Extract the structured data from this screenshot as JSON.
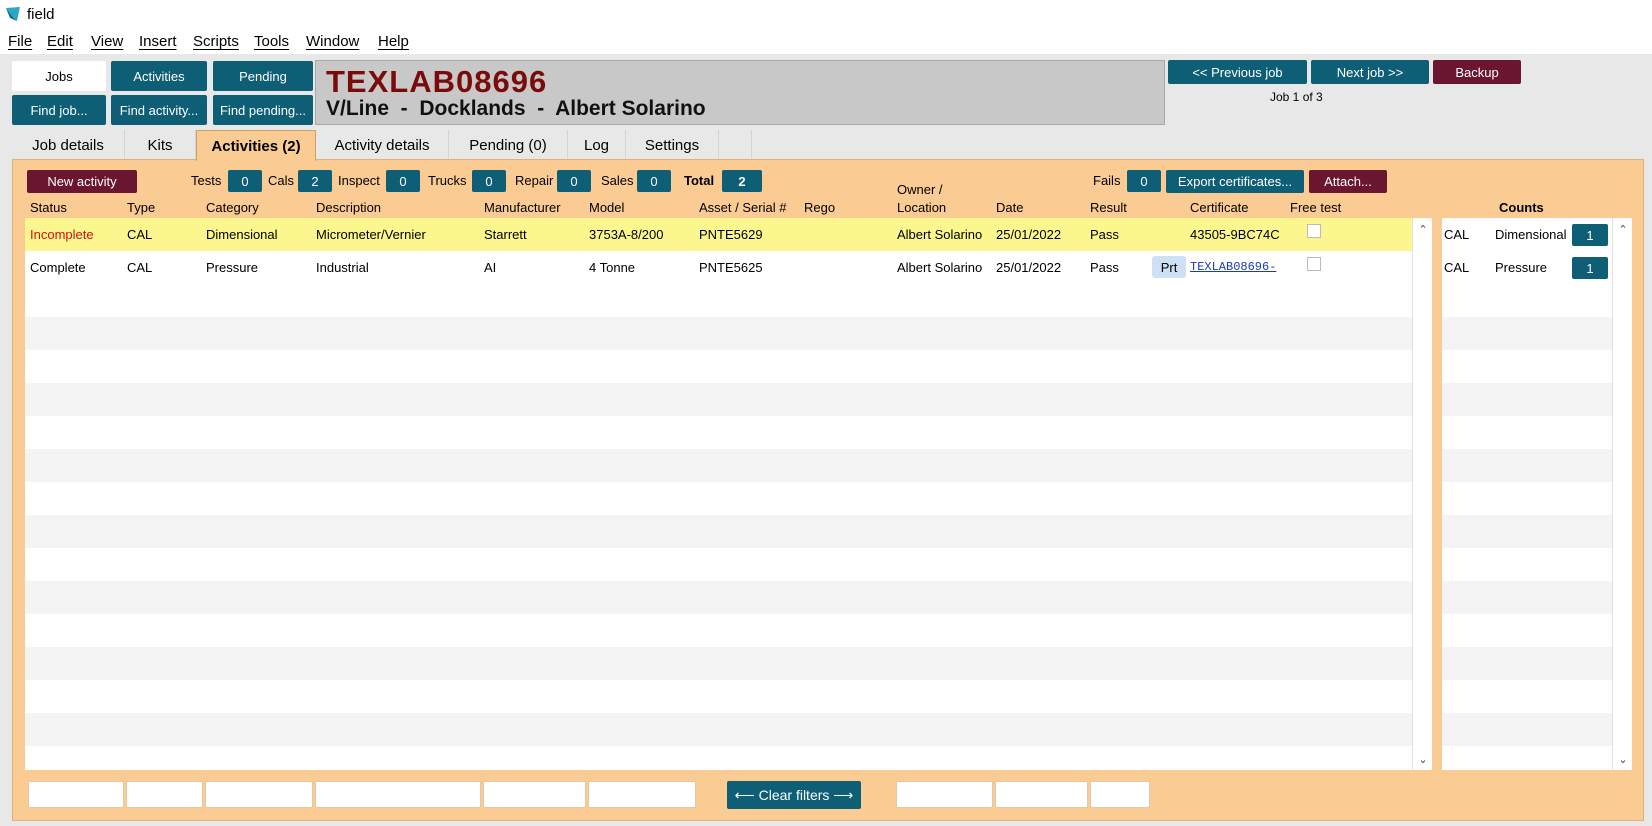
{
  "window": {
    "title": "field"
  },
  "menu": [
    {
      "key": "F",
      "rest": "ile"
    },
    {
      "key": "E",
      "rest": "dit"
    },
    {
      "key": "V",
      "rest": "iew"
    },
    {
      "key": "I",
      "rest": "nsert"
    },
    {
      "key": "S",
      "rest": "cripts"
    },
    {
      "key": "T",
      "rest": "ools"
    },
    {
      "key": "W",
      "rest": "indow"
    },
    {
      "key": "H",
      "rest": "elp"
    }
  ],
  "nav": {
    "jobs": "Jobs",
    "activities": "Activities",
    "pending": "Pending",
    "find_job": "Find job...",
    "find_activity": "Find activity...",
    "find_pending": "Find pending..."
  },
  "job": {
    "code": "TEXLAB08696",
    "subtitle": "V/Line  -  Docklands  -  Albert Solarino",
    "prev": "<< Previous job",
    "next": "Next job >>",
    "backup": "Backup",
    "count": "Job 1 of 3"
  },
  "tabs": [
    "Job details",
    "Kits",
    "Activities (2)",
    "Activity details",
    "Pending (0)",
    "Log",
    "Settings"
  ],
  "toolbar": {
    "new_activity": "New activity",
    "tests_label": "Tests",
    "tests": "0",
    "cals_label": "Cals",
    "cals": "2",
    "inspect_label": "Inspect",
    "inspect": "0",
    "trucks_label": "Trucks",
    "trucks": "0",
    "repair_label": "Repair",
    "repair": "0",
    "sales_label": "Sales",
    "sales": "0",
    "total_label": "Total",
    "total": "2",
    "fails_label": "Fails",
    "fails": "0",
    "export": "Export certificates...",
    "attach": "Attach..."
  },
  "columns": {
    "status": "Status",
    "type": "Type",
    "category": "Category",
    "description": "Description",
    "manufacturer": "Manufacturer",
    "model": "Model",
    "asset": "Asset / Serial #",
    "rego": "Rego",
    "owner1": "Owner /",
    "owner2": "Location",
    "date": "Date",
    "result": "Result",
    "certificate": "Certificate",
    "free_test": "Free test",
    "counts": "Counts"
  },
  "rows": [
    {
      "status": "Incomplete",
      "type": "CAL",
      "category": "Dimensional",
      "description": "Micrometer/Vernier",
      "manufacturer": "Starrett",
      "model": "3753A-8/200",
      "asset": "PNTE5629",
      "rego": "",
      "owner": "Albert Solarino",
      "date": "25/01/2022",
      "result": "Pass",
      "certificate": "43505-9BC74C"
    },
    {
      "status": "Complete",
      "type": "CAL",
      "category": "Pressure",
      "description": "Industrial",
      "manufacturer": "AI",
      "model": "4 Tonne",
      "asset": "PNTE5625",
      "rego": "",
      "owner": "Albert Solarino",
      "date": "25/01/2022",
      "result": "Pass",
      "prt": "Prt",
      "certificate": "TEXLAB08696-"
    }
  ],
  "counts": [
    {
      "type": "CAL",
      "category": "Dimensional",
      "count": "1"
    },
    {
      "type": "CAL",
      "category": "Pressure",
      "count": "1"
    }
  ],
  "footer": {
    "clear_filters": "⟵ Clear filters ⟶"
  },
  "colors": {
    "teal": "#0e5e76",
    "maroon": "#6b1630",
    "panel": "#fbcb94",
    "selected_row": "#fbf78e",
    "incomplete": "#d41010",
    "job_code": "#7a0b0b"
  }
}
